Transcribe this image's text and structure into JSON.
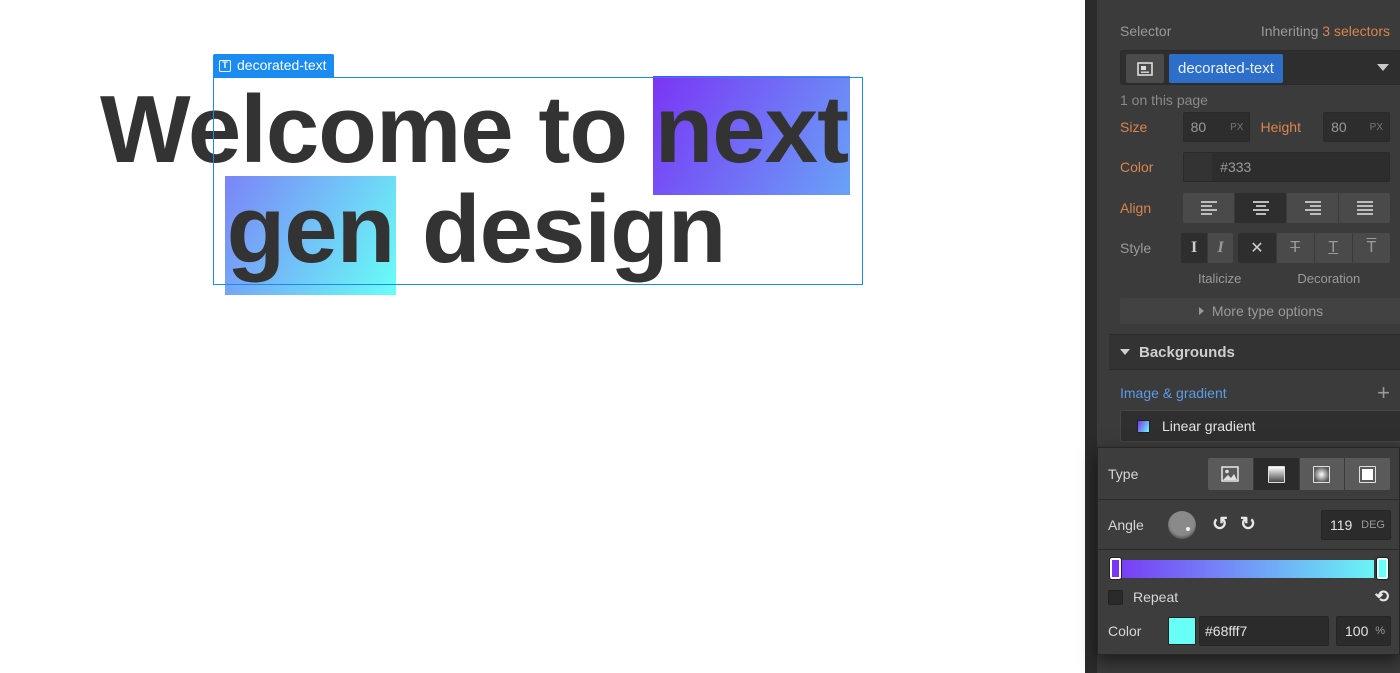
{
  "canvas": {
    "headline_line1_plain": "Welcome to ",
    "headline_line1_highlight": "next",
    "headline_line2_highlight": "gen",
    "headline_line2_plain": " design",
    "element_tag": "decorated-text"
  },
  "panel": {
    "selector_label": "Selector",
    "inheriting_prefix": "Inheriting ",
    "inheriting_count": "3 selectors",
    "selector_chip": "decorated-text",
    "on_page": "1 on this page",
    "size_label": "Size",
    "size_value": "80",
    "size_unit": "PX",
    "height_label": "Height",
    "height_value": "80",
    "height_unit": "PX",
    "color_label": "Color",
    "color_value": "#333",
    "align_label": "Align",
    "style_label": "Style",
    "italicize_label": "Italicize",
    "decoration_label": "Decoration",
    "more_type": "More type options",
    "backgrounds_header": "Backgrounds",
    "image_gradient": "Image & gradient",
    "linear_gradient": "Linear gradient"
  },
  "popup": {
    "type_label": "Type",
    "angle_label": "Angle",
    "angle_value": "119",
    "angle_unit": "DEG",
    "repeat_label": "Repeat",
    "color_label": "Color",
    "color_hex": "#68fff7",
    "opacity_value": "100",
    "opacity_unit": "%"
  },
  "colors": {
    "selection_blue": "#1a8bf1",
    "text_color": "#333333",
    "gradient_start": "#7a35f5",
    "gradient_end": "#68fff7",
    "accent_orange": "#d8864d",
    "link_blue": "#5b9be6"
  },
  "icons": {
    "text_element": "text-block-icon",
    "selector": "selector-element-icon",
    "align": [
      "align-left-icon",
      "align-center-icon",
      "align-right-icon",
      "align-justify-icon"
    ],
    "style": [
      "italic-off-icon",
      "italic-on-icon",
      "no-decoration-icon",
      "strikethrough-icon",
      "underline-icon",
      "overline-icon"
    ],
    "type": [
      "image-type-icon",
      "linear-gradient-type-icon",
      "radial-gradient-type-icon",
      "solid-color-type-icon"
    ]
  }
}
